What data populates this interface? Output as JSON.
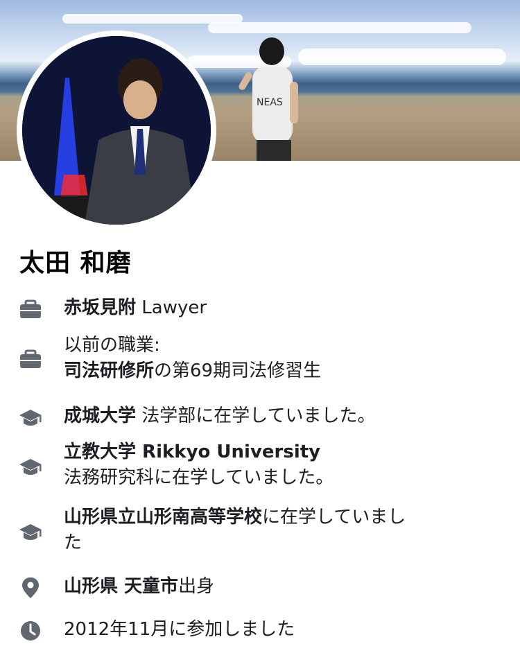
{
  "profile": {
    "name": "太田 和磨",
    "items": [
      {
        "icon": "briefcase-icon",
        "bold": "赤坂見附",
        "rest": " Lawyer"
      },
      {
        "icon": "briefcase-icon",
        "line1": "以前の職業:",
        "bold": "司法研修所",
        "rest": "の第69期司法修習生"
      },
      {
        "icon": "graduation-cap-icon",
        "bold": "成城大学",
        "rest": " 法学部に在学していました。"
      },
      {
        "icon": "graduation-cap-icon",
        "bold": "立教大学 Rikkyo University",
        "line2": "法務研究科に在学していました。"
      },
      {
        "icon": "graduation-cap-icon",
        "bold": "山形県立山形南高等学校",
        "rest": "に在学していまし",
        "line2": "た"
      },
      {
        "icon": "location-pin-icon",
        "bold": "山形県 天童市",
        "rest": "出身"
      },
      {
        "icon": "clock-icon",
        "rest": "2012年11月に参加しました"
      }
    ]
  },
  "colors": {
    "icon": "#606770",
    "text": "#1c1e21",
    "name": "#050505"
  }
}
